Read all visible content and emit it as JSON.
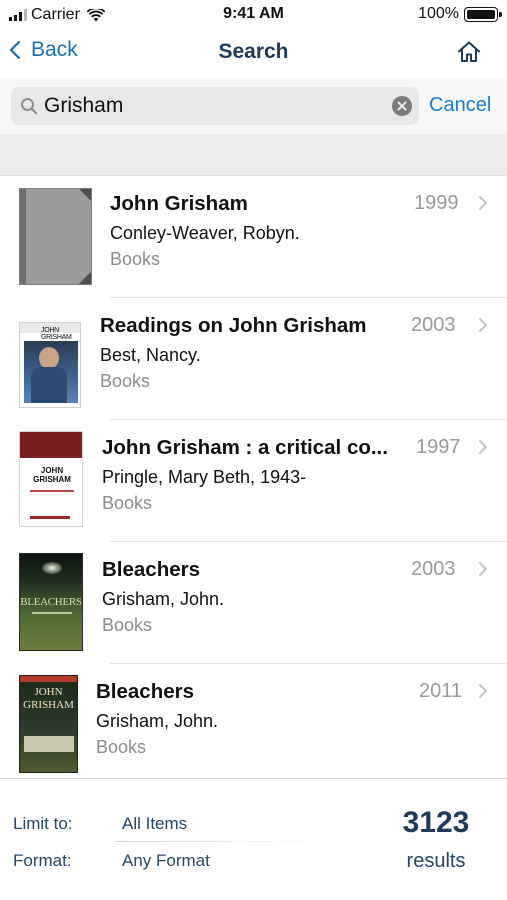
{
  "status_bar": {
    "carrier": "Carrier",
    "time": "9:41 AM",
    "battery": "100%"
  },
  "nav": {
    "back_label": "Back",
    "title": "Search"
  },
  "search": {
    "value": "Grisham",
    "placeholder": "Search",
    "cancel_label": "Cancel"
  },
  "results": [
    {
      "title": "John Grisham",
      "author": "Conley-Weaver, Robyn.",
      "type": "Books",
      "year": "1999"
    },
    {
      "title": "Readings on John Grisham",
      "author": "Best, Nancy.",
      "type": "Books",
      "year": "2003",
      "cover_text": "JOHN GRISHAM"
    },
    {
      "title": "John Grisham : a critical co...",
      "author": "Pringle, Mary Beth, 1943-",
      "type": "Books",
      "year": "1997",
      "cover_text": "JOHN GRISHAM"
    },
    {
      "title": "Bleachers",
      "author": "Grisham, John.",
      "type": "Books",
      "year": "2003",
      "cover_text": "BLEACHERS"
    },
    {
      "title": "Bleachers",
      "author": "Grisham, John.",
      "type": "Books",
      "year": "2011",
      "cover_text": "JOHN GRISHAM"
    }
  ],
  "footer": {
    "limit_label": "Limit to:",
    "limit_value": "All Items",
    "format_label": "Format:",
    "format_value": "Any Format",
    "count": "3123",
    "count_label": "results"
  },
  "colors": {
    "accent": "#1b7bd8",
    "nav_title": "#1e3a5c",
    "muted": "#9a9a9a"
  },
  "icons": [
    "signal-icon",
    "wifi-icon",
    "battery-icon",
    "back-chevron-icon",
    "home-icon",
    "search-icon",
    "clear-icon",
    "chevron-right-icon"
  ]
}
